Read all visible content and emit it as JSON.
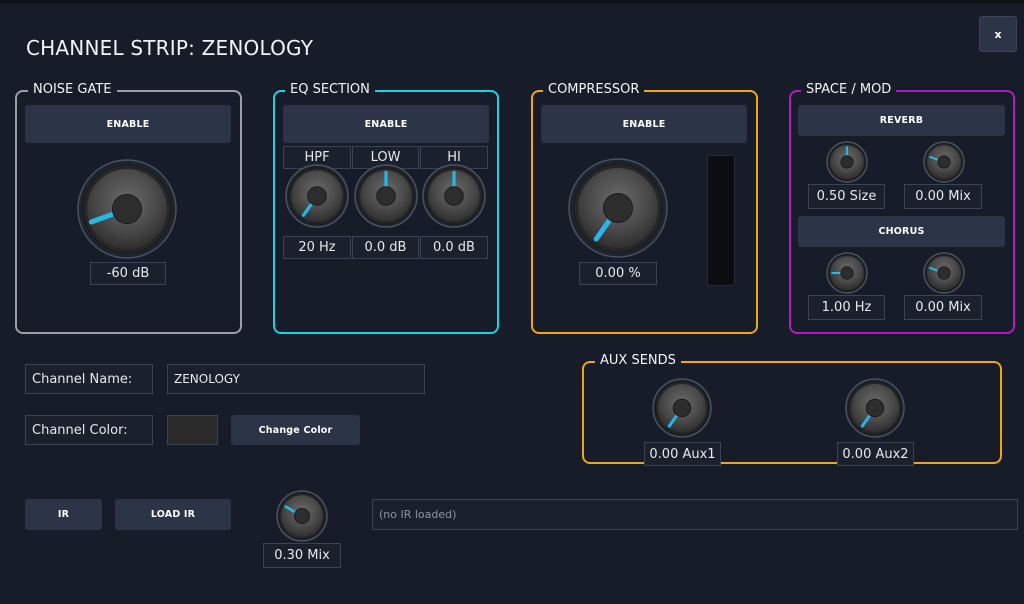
{
  "window": {
    "title": "CHANNEL STRIP: ZENOLOGY",
    "close_label": "x"
  },
  "noise_gate": {
    "label": "NOISE GATE",
    "enable_label": "ENABLE",
    "value": "-60 dB"
  },
  "eq": {
    "label": "EQ SECTION",
    "enable_label": "ENABLE",
    "bands": [
      {
        "label": "HPF",
        "value": "20 Hz"
      },
      {
        "label": "LOW",
        "value": "0.0 dB"
      },
      {
        "label": "HI",
        "value": "0.0 dB"
      }
    ]
  },
  "compressor": {
    "label": "COMPRESSOR",
    "enable_label": "ENABLE",
    "value": "0.00 %"
  },
  "space_mod": {
    "label": "SPACE / MOD",
    "reverb_label": "REVERB",
    "reverb_size": "0.50 Size",
    "reverb_mix": "0.00 Mix",
    "chorus_label": "CHORUS",
    "chorus_rate": "1.00 Hz",
    "chorus_mix": "0.00 Mix"
  },
  "aux_sends": {
    "label": "AUX SENDS",
    "aux1": "0.00 Aux1",
    "aux2": "0.00 Aux2"
  },
  "channel": {
    "name_label": "Channel Name:",
    "name_value": "ZENOLOGY",
    "color_label": "Channel Color:",
    "change_color_label": "Change Color"
  },
  "ir": {
    "ir_label": "IR",
    "load_ir_label": "LOAD IR",
    "mix": "0.30 Mix",
    "status": "(no IR loaded)"
  },
  "colors": {
    "background": "#171d28",
    "noise_gate_border": "#9aa0a6",
    "eq_border": "#17d4e3",
    "compressor_border": "#f0a416",
    "space_mod_border": "#b418c4",
    "aux_border": "#f0a416",
    "knob_indicator": "#27b7e6"
  }
}
